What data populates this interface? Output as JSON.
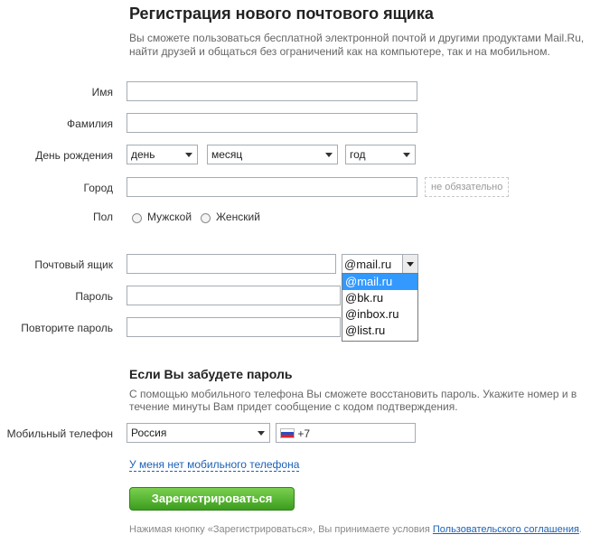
{
  "page": {
    "title": "Регистрация нового почтового ящика",
    "description": "Вы сможете пользоваться бесплатной электронной почтой и другими продуктами Mail.Ru, найти друзей и общаться без ограничений как на компьютере, так и на мобильном."
  },
  "form": {
    "first_name_label": "Имя",
    "last_name_label": "Фамилия",
    "birthday_label": "День рождения",
    "day_value": "день",
    "month_value": "месяц",
    "year_value": "год",
    "city_label": "Город",
    "city_optional": "не обязательно",
    "gender_label": "Пол",
    "male_label": "Мужской",
    "female_label": "Женский",
    "mailbox_label": "Почтовый ящик",
    "domain_value": "@mail.ru",
    "domain_options": [
      "@mail.ru",
      "@bk.ru",
      "@inbox.ru",
      "@list.ru"
    ],
    "password_label": "Пароль",
    "repeat_password_label": "Повторите пароль"
  },
  "recovery": {
    "heading": "Если Вы забудете пароль",
    "description": "С помощью мобильного телефона Вы сможете восстановить пароль. Укажите номер и в течение минуты Вам придет сообщение с кодом подтверждения.",
    "phone_label": "Мобильный телефон",
    "country_value": "Россия",
    "phone_prefix": "+7",
    "no_phone_link": "У меня нет мобильного телефона"
  },
  "submit": {
    "label": "Зарегистрироваться"
  },
  "footer": {
    "text": "Нажимая кнопку «Зарегистрироваться», Вы принимаете условия",
    "link": "Пользовательского соглашения",
    "end": "."
  },
  "colors": {
    "accent_link": "#1d61b5",
    "button_green": "#4cae2b",
    "selection_blue": "#3399ff"
  }
}
